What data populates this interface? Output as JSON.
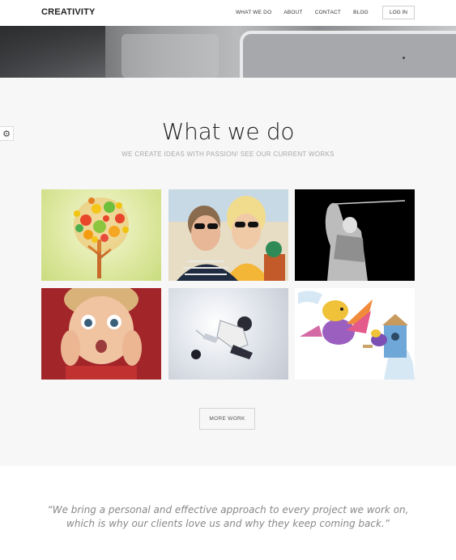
{
  "header": {
    "logo": "CREATIVITY",
    "nav": [
      "WHAT WE DO",
      "ABOUT",
      "CONTACT",
      "BLOG"
    ],
    "login_label": "LOG IN"
  },
  "main": {
    "title": "What we do",
    "subtitle": "WE CREATE IDEAS WITH PASSION! SEE OUR CURRENT WORKS",
    "more_label": "MORE WORK"
  },
  "quote": {
    "text": "“We bring a personal and effective approach to every project we work on, which is why our clients love us and why they keep coming back.”"
  },
  "icons": {
    "settings": "gear-icon"
  }
}
